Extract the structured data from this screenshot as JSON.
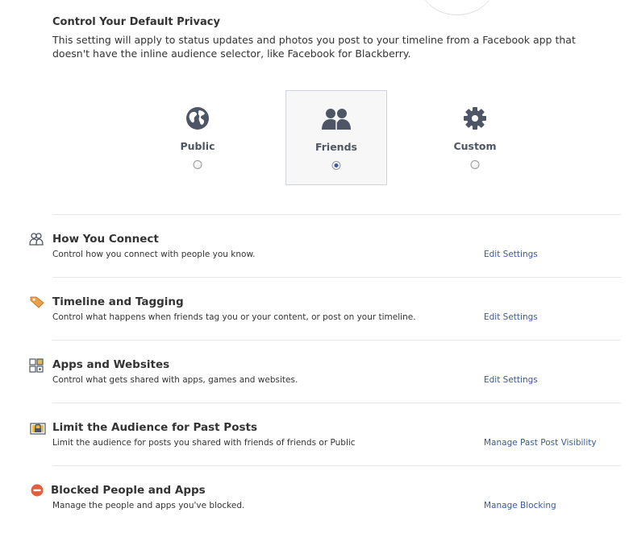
{
  "privacy": {
    "title": "Control Your Default Privacy",
    "description": "This setting will apply to status updates and photos you post to your timeline from a Facebook app that doesn't have the inline audience selector, like Facebook for Blackberry.",
    "options": [
      {
        "label": "Public",
        "icon": "globe-icon",
        "selected": false
      },
      {
        "label": "Friends",
        "icon": "friends-icon",
        "selected": true
      },
      {
        "label": "Custom",
        "icon": "gear-icon",
        "selected": false
      }
    ]
  },
  "settings": [
    {
      "title": "How You Connect",
      "description": "Control how you connect with people you know.",
      "link": "Edit Settings",
      "icon": "people-icon"
    },
    {
      "title": "Timeline and Tagging",
      "description": "Control what happens when friends tag you or your content, or post on your timeline.",
      "link": "Edit Settings",
      "icon": "tag-icon"
    },
    {
      "title": "Apps and Websites",
      "description": "Control what gets shared with apps, games and websites.",
      "link": "Edit Settings",
      "icon": "apps-icon"
    },
    {
      "title": "Limit the Audience for Past Posts",
      "description": "Limit the audience for posts you shared with friends of friends or Public",
      "link": "Manage Past Post Visibility",
      "icon": "lock-icon"
    },
    {
      "title": "Blocked People and Apps",
      "description": "Manage the people and apps you've blocked.",
      "link": "Manage Blocking",
      "icon": "block-icon"
    }
  ],
  "colors": {
    "link": "#3b5998",
    "icon_gray": "#4e5665",
    "tag_orange": "#e8a04a",
    "block_red": "#e45d3c",
    "lock_yellow": "#e8b84a"
  }
}
